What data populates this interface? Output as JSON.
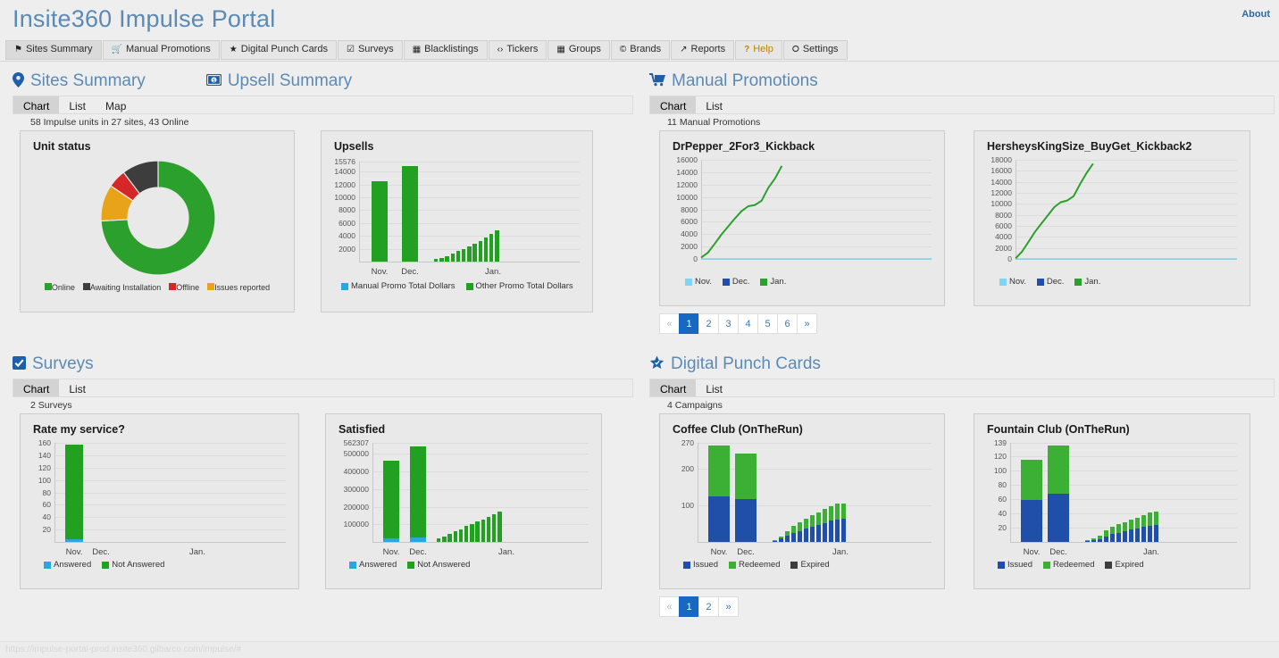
{
  "app": {
    "title": "Insite360 Impulse Portal",
    "about_label": "About",
    "status_url": "https://impulse-portal-prod.insite360.gilbarco.com/impulse/#"
  },
  "nav": {
    "items": [
      {
        "label": "Sites Summary",
        "icon": "map-pin-icon",
        "glyph": "⚑",
        "active": true
      },
      {
        "label": "Manual Promotions",
        "icon": "shopping-cart-icon",
        "glyph": "🛒",
        "active": false
      },
      {
        "label": "Digital Punch Cards",
        "icon": "star-icon",
        "glyph": "★",
        "active": false
      },
      {
        "label": "Surveys",
        "icon": "checkbox-icon",
        "glyph": "☑",
        "active": false
      },
      {
        "label": "Blacklistings",
        "icon": "calendar-icon",
        "glyph": "▦",
        "active": false
      },
      {
        "label": "Tickers",
        "icon": "code-icon",
        "glyph": "‹›",
        "active": false
      },
      {
        "label": "Groups",
        "icon": "grid-icon",
        "glyph": "▦",
        "active": false
      },
      {
        "label": "Brands",
        "icon": "copyright-icon",
        "glyph": "©",
        "active": false
      },
      {
        "label": "Reports",
        "icon": "chart-line-icon",
        "glyph": "↗",
        "active": false
      },
      {
        "label": "Help",
        "icon": "question-icon",
        "glyph": "?",
        "active": false
      },
      {
        "label": "Settings",
        "icon": "gear-icon",
        "glyph": "⭘",
        "active": false
      }
    ]
  },
  "sites_summary": {
    "title": "Sites Summary",
    "icon": "map-pin-icon",
    "tabs": [
      {
        "label": "Chart",
        "active": true
      },
      {
        "label": "List",
        "active": false
      },
      {
        "label": "Map",
        "active": false
      }
    ],
    "count_line": "58 Impulse units in 27 sites, 43 Online"
  },
  "upsell_summary": {
    "title": "Upsell Summary",
    "icon": "money-icon"
  },
  "manual_promotions": {
    "title": "Manual Promotions",
    "icon": "shopping-cart-icon",
    "tabs": [
      {
        "label": "Chart",
        "active": true
      },
      {
        "label": "List",
        "active": false
      }
    ],
    "count_line": "11 Manual Promotions",
    "pager": [
      {
        "label": "«",
        "state": "disabled"
      },
      {
        "label": "1",
        "state": "active"
      },
      {
        "label": "2",
        "state": "normal"
      },
      {
        "label": "3",
        "state": "normal"
      },
      {
        "label": "4",
        "state": "normal"
      },
      {
        "label": "5",
        "state": "normal"
      },
      {
        "label": "6",
        "state": "normal"
      },
      {
        "label": "»",
        "state": "normal"
      }
    ]
  },
  "surveys": {
    "title": "Surveys",
    "icon": "checkbox-icon",
    "tabs": [
      {
        "label": "Chart",
        "active": true
      },
      {
        "label": "List",
        "active": false
      }
    ],
    "count_line": "2 Surveys"
  },
  "punch_cards": {
    "title": "Digital Punch Cards",
    "icon": "star-icon",
    "tabs": [
      {
        "label": "Chart",
        "active": true
      },
      {
        "label": "List",
        "active": false
      }
    ],
    "count_line": "4 Campaigns",
    "pager": [
      {
        "label": "«",
        "state": "disabled"
      },
      {
        "label": "1",
        "state": "active"
      },
      {
        "label": "2",
        "state": "normal"
      },
      {
        "label": "»",
        "state": "normal"
      }
    ]
  },
  "colors": {
    "green": "#2ca02c",
    "green_bar": "#22a022",
    "blue_dark": "#1f4fa8",
    "blue_light": "#29a8df",
    "orange": "#e8a319",
    "red": "#d62728",
    "dark": "#3d3d3d",
    "accent": "#5b8ab5",
    "pager_active": "#1668c3"
  },
  "chart_data": [
    {
      "id": "unit-status-donut",
      "type": "pie",
      "title": "Unit status",
      "categories": [
        "Online",
        "Awaiting Installation",
        "Offline",
        "Issues reported"
      ],
      "values": [
        43,
        6,
        3,
        6
      ],
      "colors": [
        "#2ca02c",
        "#3d3d3d",
        "#d62728",
        "#e8a319"
      ],
      "legend_position": "bottom",
      "donut": true
    },
    {
      "id": "upsells",
      "type": "bar",
      "title": "Upsells",
      "stacked": true,
      "ylim": [
        0,
        15576
      ],
      "yticks": [
        15576,
        14000,
        12000,
        10000,
        8000,
        6000,
        4000,
        2000
      ],
      "xlabels": [
        "Nov.",
        "Dec.",
        "Jan."
      ],
      "grid": true,
      "series": [
        {
          "name": "Manual Promo Total Dollars",
          "color": "#29a8df"
        },
        {
          "name": "Other Promo Total Dollars",
          "color": "#22a022"
        }
      ],
      "month_bars": {
        "Nov.": 12550,
        "Dec.": 14900
      },
      "jan_daily": [
        380,
        620,
        900,
        1250,
        1600,
        1950,
        2350,
        2750,
        3200,
        3700,
        4250,
        4900
      ]
    },
    {
      "id": "drpepper-2for3-kickback",
      "type": "line",
      "title": "DrPepper_2For3_Kickback",
      "ylim": [
        0,
        16000
      ],
      "yticks": [
        16000,
        14000,
        12000,
        10000,
        8000,
        6000,
        4000,
        2000,
        0
      ],
      "xlabels": [
        "Nov.",
        "Dec.",
        "Jan."
      ],
      "series": [
        {
          "name": "Nov.",
          "color": "#7fd4ef",
          "values": [
            0,
            0
          ]
        },
        {
          "name": "Dec.",
          "color": "#1f4fa8",
          "values": [
            0,
            0
          ]
        },
        {
          "name": "Jan.",
          "color": "#2ca02c",
          "values": [
            200,
            1000,
            2400,
            3900,
            5200,
            6500,
            7700,
            8500,
            8700,
            9400,
            11500,
            13000,
            15000
          ]
        }
      ]
    },
    {
      "id": "hersheys-kingsize-buyget-kickback2",
      "type": "line",
      "title": "HersheysKingSize_BuyGet_Kickback2",
      "ylim": [
        0,
        18000
      ],
      "yticks": [
        18000,
        16000,
        14000,
        12000,
        10000,
        8000,
        6000,
        4000,
        2000,
        0
      ],
      "xlabels": [
        "Nov.",
        "Dec.",
        "Jan."
      ],
      "series": [
        {
          "name": "Nov.",
          "color": "#7fd4ef",
          "values": [
            0,
            0
          ]
        },
        {
          "name": "Dec.",
          "color": "#1f4fa8",
          "values": [
            0,
            0
          ]
        },
        {
          "name": "Jan.",
          "color": "#2ca02c",
          "values": [
            100,
            1300,
            3100,
            4900,
            6400,
            7900,
            9400,
            10300,
            10600,
            11400,
            13600,
            15600,
            17300
          ]
        }
      ]
    },
    {
      "id": "rate-my-service",
      "type": "bar",
      "title": "Rate my service?",
      "stacked": true,
      "ylim": [
        0,
        160
      ],
      "yticks": [
        160,
        140,
        120,
        100,
        80,
        60,
        40,
        20
      ],
      "xlabels": [
        "Nov.",
        "Dec.",
        "Jan."
      ],
      "series": [
        {
          "name": "Answered",
          "color": "#29a8df"
        },
        {
          "name": "Not Answered",
          "color": "#22a022"
        }
      ],
      "month_bars": {
        "Nov.": {
          "Answered": 4,
          "Not Answered": 153
        }
      },
      "jan_daily": []
    },
    {
      "id": "satisfied",
      "type": "bar",
      "title": "Satisfied",
      "stacked": true,
      "ylim": [
        0,
        562307
      ],
      "yticks": [
        562307,
        500000,
        400000,
        300000,
        200000,
        100000
      ],
      "xlabels": [
        "Nov.",
        "Dec.",
        "Jan."
      ],
      "series": [
        {
          "name": "Answered",
          "color": "#29a8df"
        },
        {
          "name": "Not Answered",
          "color": "#22a022"
        }
      ],
      "month_bars": {
        "Nov.": {
          "Answered": 19000,
          "Not Answered": 441000
        },
        "Dec.": {
          "Answered": 26000,
          "Not Answered": 516000
        }
      },
      "jan_daily": [
        18000,
        31000,
        47000,
        60000,
        72000,
        89000,
        101000,
        115000,
        129000,
        144000,
        157000,
        171000
      ]
    },
    {
      "id": "coffee-club-ontherun",
      "type": "bar",
      "title": "Coffee Club (OnTheRun)",
      "stacked": true,
      "ylim": [
        0,
        270
      ],
      "yticks": [
        270,
        200,
        100
      ],
      "xlabels": [
        "Nov.",
        "Dec.",
        "Jan."
      ],
      "series": [
        {
          "name": "Issued",
          "color": "#1f4fa8"
        },
        {
          "name": "Redeemed",
          "color": "#3cb034"
        },
        {
          "name": "Expired",
          "color": "#3d3d3d"
        }
      ],
      "month_bars": {
        "Nov.": {
          "Issued": 124,
          "Redeemed": 139
        },
        "Dec.": {
          "Issued": 117,
          "Redeemed": 123
        }
      },
      "jan_daily": [
        {
          "Issued": 4,
          "Redeemed": 2
        },
        {
          "Issued": 9,
          "Redeemed": 6
        },
        {
          "Issued": 16,
          "Redeemed": 13
        },
        {
          "Issued": 24,
          "Redeemed": 19
        },
        {
          "Issued": 30,
          "Redeemed": 23
        },
        {
          "Issued": 36,
          "Redeemed": 28
        },
        {
          "Issued": 41,
          "Redeemed": 31
        },
        {
          "Issued": 46,
          "Redeemed": 35
        },
        {
          "Issued": 52,
          "Redeemed": 38
        },
        {
          "Issued": 58,
          "Redeemed": 40
        },
        {
          "Issued": 62,
          "Redeemed": 43
        },
        {
          "Issued": 63,
          "Redeemed": 42
        }
      ]
    },
    {
      "id": "fountain-club-ontherun",
      "type": "bar",
      "title": "Fountain Club (OnTheRun)",
      "stacked": true,
      "ylim": [
        0,
        139
      ],
      "yticks": [
        139,
        120,
        100,
        80,
        60,
        40,
        20
      ],
      "xlabels": [
        "Nov.",
        "Dec.",
        "Jan."
      ],
      "series": [
        {
          "name": "Issued",
          "color": "#1f4fa8"
        },
        {
          "name": "Redeemed",
          "color": "#3cb034"
        },
        {
          "name": "Expired",
          "color": "#3d3d3d"
        }
      ],
      "month_bars": {
        "Nov.": {
          "Issued": 59,
          "Redeemed": 56
        },
        "Dec.": {
          "Issued": 68,
          "Redeemed": 67
        }
      },
      "jan_daily": [
        {
          "Issued": 1,
          "Redeemed": 2
        },
        {
          "Issued": 2,
          "Redeemed": 3
        },
        {
          "Issued": 4,
          "Redeemed": 5
        },
        {
          "Issued": 8,
          "Redeemed": 8
        },
        {
          "Issued": 11,
          "Redeemed": 10
        },
        {
          "Issued": 13,
          "Redeemed": 12
        },
        {
          "Issued": 15,
          "Redeemed": 13
        },
        {
          "Issued": 17,
          "Redeemed": 14
        },
        {
          "Issued": 19,
          "Redeemed": 15
        },
        {
          "Issued": 21,
          "Redeemed": 16
        },
        {
          "Issued": 23,
          "Redeemed": 18
        },
        {
          "Issued": 24,
          "Redeemed": 19
        }
      ]
    }
  ]
}
